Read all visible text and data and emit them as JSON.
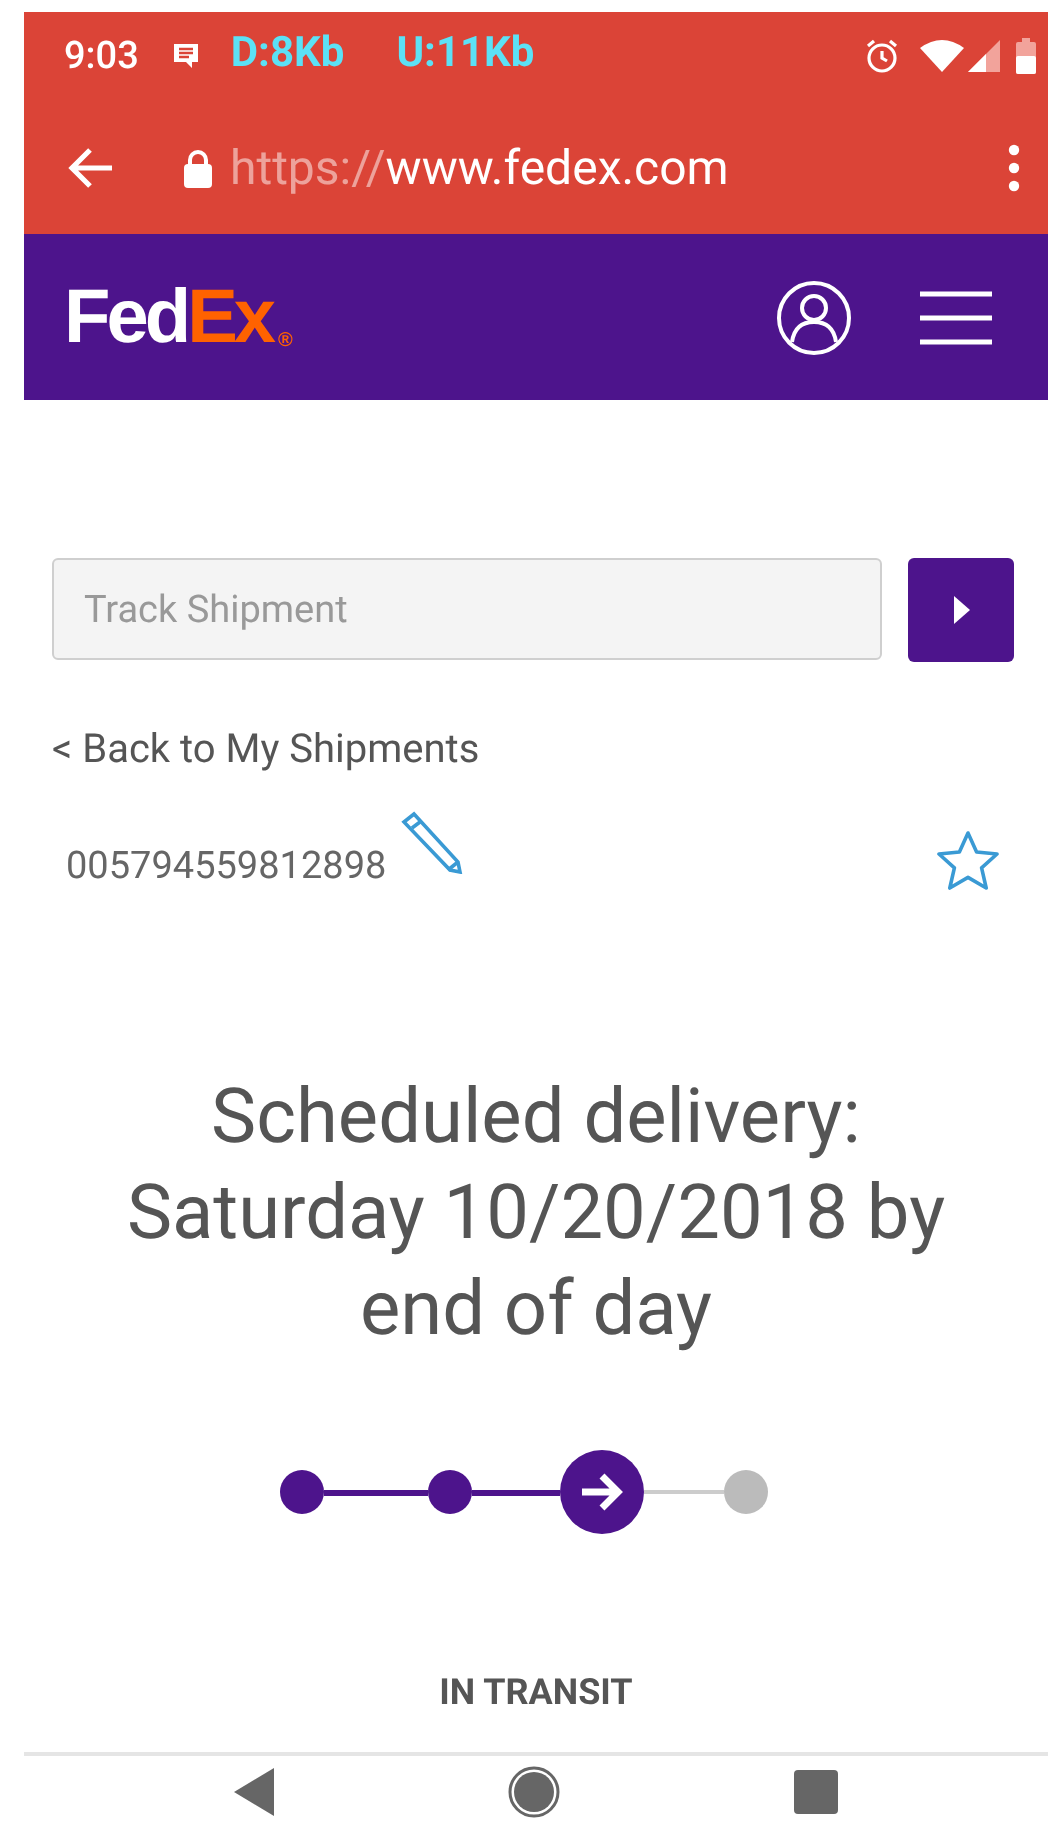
{
  "status_bar": {
    "time": "9:03",
    "download": "D:8Kb",
    "upload": "U:11Kb"
  },
  "browser": {
    "url_scheme": "https://",
    "url_host": "www.fedex.com"
  },
  "header": {
    "logo_first": "Fed",
    "logo_second": "Ex",
    "logo_mark": "®"
  },
  "search": {
    "placeholder": "Track Shipment"
  },
  "back_link": "< Back to My Shipments",
  "tracking_number": "005794559812898",
  "favorite": {
    "selected": false
  },
  "headline": "Scheduled delivery: Saturday 10/20/2018 by end of day",
  "steps": [
    {
      "kind": "done"
    },
    {
      "kind": "done"
    },
    {
      "kind": "current"
    },
    {
      "kind": "pending"
    }
  ],
  "status_label": "IN TRANSIT"
}
